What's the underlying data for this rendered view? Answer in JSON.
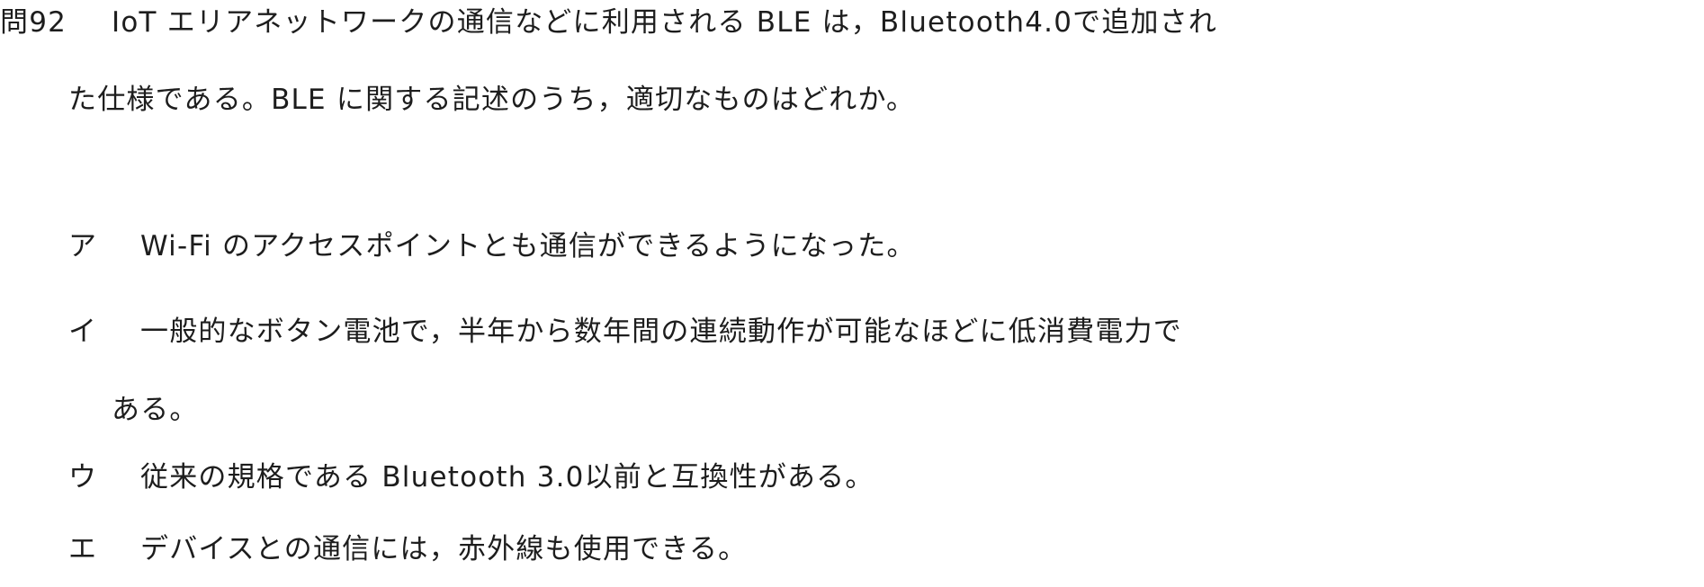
{
  "question": {
    "number": "問92",
    "text_line1": "IoT エリアネットワークの通信などに利用される BLE は，Bluetooth4.0で追加され",
    "text_line2": "た仕様である。BLE に関する記述のうち，適切なものはどれか。"
  },
  "options": [
    {
      "label": "ア",
      "text": "Wi-Fi のアクセスポイントとも通信ができるようになった。"
    },
    {
      "label": "イ",
      "text": "一般的なボタン電池で，半年から数年間の連続動作が可能なほどに低消費電力で",
      "continuation": "ある。"
    },
    {
      "label": "ウ",
      "text": "従来の規格である Bluetooth 3.0以前と互換性がある。"
    },
    {
      "label": "エ",
      "text": "デバイスとの通信には，赤外線も使用できる。"
    }
  ]
}
